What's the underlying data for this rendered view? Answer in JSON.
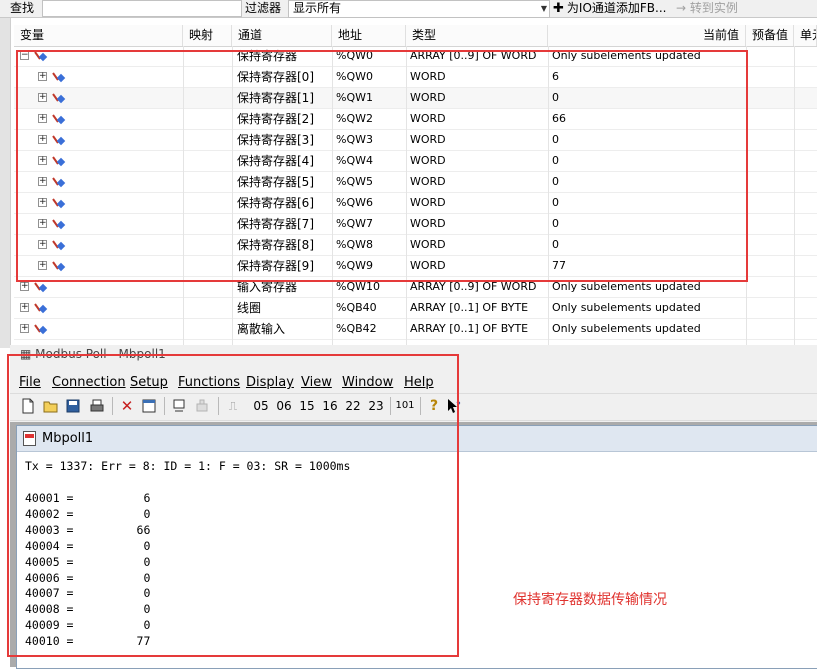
{
  "toolbar": {
    "find_label": "查找",
    "filter_label": "过滤器",
    "filter_value": "显示所有",
    "add_fb_label": "为IO通道添加FB...",
    "goto_label": "转到实例"
  },
  "table": {
    "columns": [
      "变量",
      "映射",
      "通道",
      "地址",
      "类型",
      "当前值",
      "预备值",
      "单元"
    ],
    "rows": [
      {
        "channel": "保持寄存器",
        "address": "%QW0",
        "type": "ARRAY [0..9] OF WORD",
        "value": "Only subelements updated"
      },
      {
        "channel": "保持寄存器[0]",
        "address": "%QW0",
        "type": "WORD",
        "value": "6"
      },
      {
        "channel": "保持寄存器[1]",
        "address": "%QW1",
        "type": "WORD",
        "value": "0"
      },
      {
        "channel": "保持寄存器[2]",
        "address": "%QW2",
        "type": "WORD",
        "value": "66"
      },
      {
        "channel": "保持寄存器[3]",
        "address": "%QW3",
        "type": "WORD",
        "value": "0"
      },
      {
        "channel": "保持寄存器[4]",
        "address": "%QW4",
        "type": "WORD",
        "value": "0"
      },
      {
        "channel": "保持寄存器[5]",
        "address": "%QW5",
        "type": "WORD",
        "value": "0"
      },
      {
        "channel": "保持寄存器[6]",
        "address": "%QW6",
        "type": "WORD",
        "value": "0"
      },
      {
        "channel": "保持寄存器[7]",
        "address": "%QW7",
        "type": "WORD",
        "value": "0"
      },
      {
        "channel": "保持寄存器[8]",
        "address": "%QW8",
        "type": "WORD",
        "value": "0"
      },
      {
        "channel": "保持寄存器[9]",
        "address": "%QW9",
        "type": "WORD",
        "value": "77"
      },
      {
        "channel": "输入寄存器",
        "address": "%QW10",
        "type": "ARRAY [0..9] OF WORD",
        "value": "Only subelements updated"
      },
      {
        "channel": "线圈",
        "address": "%QB40",
        "type": "ARRAY [0..1] OF BYTE",
        "value": "Only subelements updated"
      },
      {
        "channel": "离散输入",
        "address": "%QB42",
        "type": "ARRAY [0..1] OF BYTE",
        "value": "Only subelements updated"
      }
    ]
  },
  "modbus": {
    "window_title": "Modbus Poll - Mbpoll1",
    "menu": [
      "File",
      "Connection",
      "Setup",
      "Functions",
      "Display",
      "View",
      "Window",
      "Help"
    ],
    "toolbar_codes": [
      "05",
      "06",
      "15",
      "16",
      "22",
      "23",
      "101"
    ],
    "child_title": "Mbpoll1",
    "status_line": "Tx = 1337: Err = 8: ID = 1: F = 03: SR = 1000ms",
    "registers": [
      {
        "address": "40001",
        "value": "6"
      },
      {
        "address": "40002",
        "value": "0"
      },
      {
        "address": "40003",
        "value": "66"
      },
      {
        "address": "40004",
        "value": "0"
      },
      {
        "address": "40005",
        "value": "0"
      },
      {
        "address": "40006",
        "value": "0"
      },
      {
        "address": "40007",
        "value": "0"
      },
      {
        "address": "40008",
        "value": "0"
      },
      {
        "address": "40009",
        "value": "0"
      },
      {
        "address": "40010",
        "value": "77"
      }
    ]
  },
  "annotation": "保持寄存器数据传输情况",
  "colors": {
    "highlight": "#e53a3a",
    "annotation": "#e0332f",
    "header_bg": "#fbfbfb"
  }
}
